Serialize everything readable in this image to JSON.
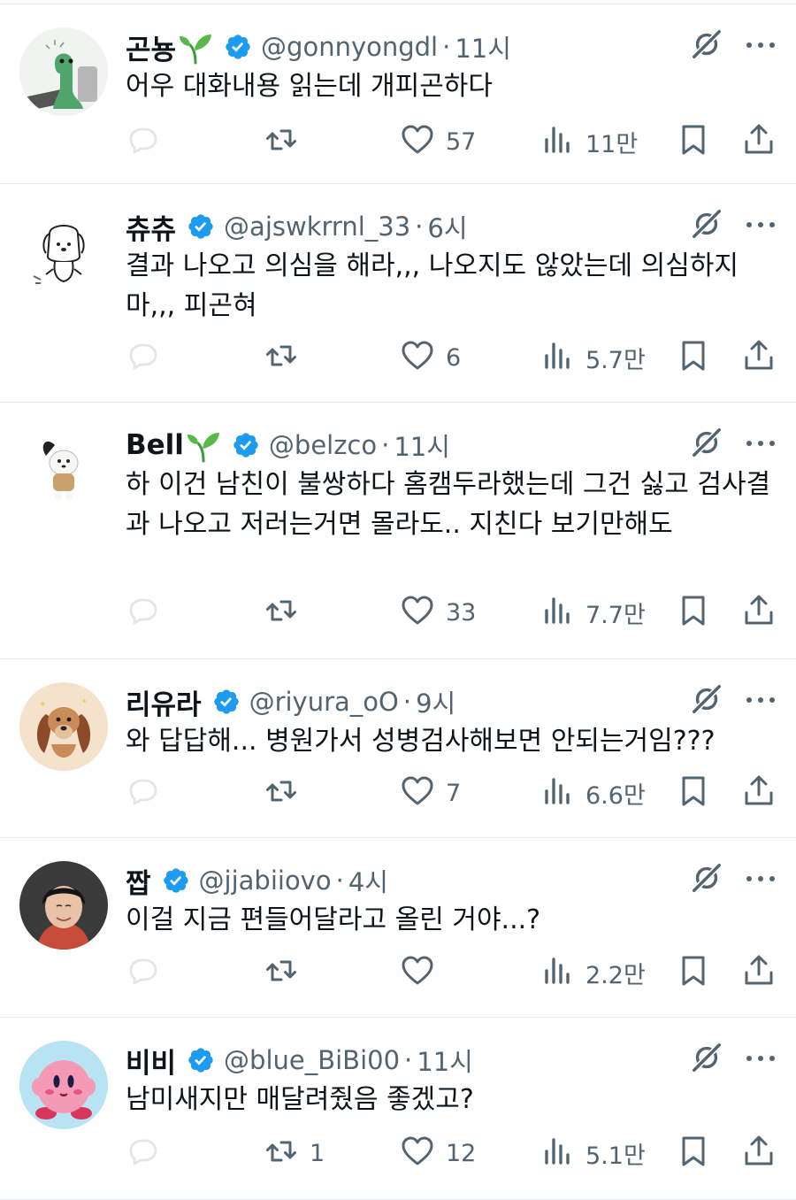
{
  "tweets": [
    {
      "name": "곤뇽",
      "has_sprout": true,
      "handle": "@gonnyongdl",
      "dot": "·",
      "time": "11시",
      "text": "어우 대화내용 읽는데 개피곤하다",
      "likes": "57",
      "retweets": "",
      "views": "11만",
      "avatar": "green-dinosaur-at-laptop"
    },
    {
      "name": "츄츄",
      "has_sprout": false,
      "handle": "@ajswkrrnl_33",
      "dot": "·",
      "time": "6시",
      "text": "결과 나오고 의심을 해라,,, 나오지도 않았는데 의심하지 마,,, 피곤혀",
      "likes": "6",
      "retweets": "",
      "views": "5.7만",
      "avatar": "puppy-sketch"
    },
    {
      "name": "Bell",
      "has_sprout": true,
      "handle": "@belzco",
      "dot": "·",
      "time": "11시",
      "text": "하 이건 남친이 불쌍하다 홈캠두라했는데 그건 싫고 검사결과 나오고 저러는거면 몰라도.. 지친다 보기만해도",
      "likes": "33",
      "retweets": "",
      "views": "7.7만",
      "avatar": "pochacco-figure"
    },
    {
      "name": "리유라",
      "has_sprout": false,
      "handle": "@riyura_oO",
      "dot": "·",
      "time": "9시",
      "text": "와 답답해... 병원가서 성병검사해보면 안되는거임???",
      "likes": "7",
      "retweets": "",
      "views": "6.6만",
      "avatar": "cartoon-dog-lady"
    },
    {
      "name": "짭",
      "has_sprout": false,
      "handle": "@jjabiiovo",
      "dot": "·",
      "time": "4시",
      "text": "이걸 지금 편들어달라고 올린 거야...?",
      "likes": "",
      "retweets": "",
      "views": "2.2만",
      "avatar": "person-photo"
    },
    {
      "name": "비비",
      "has_sprout": false,
      "handle": "@blue_BiBi00",
      "dot": "·",
      "time": "11시",
      "text": "남미새지만 매달려줬음 좋겠고?",
      "likes": "12",
      "retweets": "1",
      "views": "5.1만",
      "avatar": "pink-kirby"
    }
  ],
  "colors": {
    "text": "#0f1419",
    "secondary": "#536471",
    "verified": "#1d9bf0",
    "divider": "#e6e9ec",
    "sprout": "#4caf50"
  },
  "icons": [
    "verified-badge-icon",
    "grok-icon",
    "more-icon",
    "reply-icon",
    "retweet-icon",
    "like-icon",
    "views-icon",
    "bookmark-icon",
    "share-icon",
    "sprout-icon"
  ]
}
